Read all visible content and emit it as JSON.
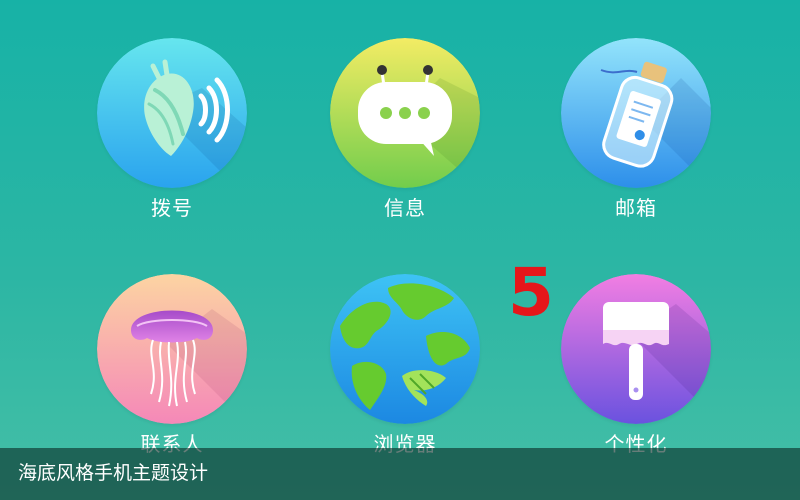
{
  "screen": {
    "background": "#1fb3a5"
  },
  "apps": [
    {
      "label": "拨号",
      "icon": "shell-phone-icon",
      "color_top": "#62e3ef",
      "color_bottom": "#2aa7ee"
    },
    {
      "label": "信息",
      "icon": "message-bubble-icon",
      "color_top": "#f0ea63",
      "color_bottom": "#76d04c"
    },
    {
      "label": "邮箱",
      "icon": "bottle-letter-icon",
      "color_top": "#8fe0fa",
      "color_bottom": "#2f95ec"
    },
    {
      "label": "联系人",
      "icon": "jellyfish-icon",
      "color_top": "#fbd0a4",
      "color_bottom": "#f58bb6"
    },
    {
      "label": "浏览器",
      "icon": "earth-globe-icon",
      "color_top": "#3cbef4",
      "color_bottom": "#1f8ee6"
    },
    {
      "label": "个性化",
      "icon": "paint-brush-icon",
      "color_top": "#f07be0",
      "color_bottom": "#6b53df"
    }
  ],
  "page_number": "5",
  "page_number_color": "#e5161a",
  "caption": "海底风格手机主题设计"
}
